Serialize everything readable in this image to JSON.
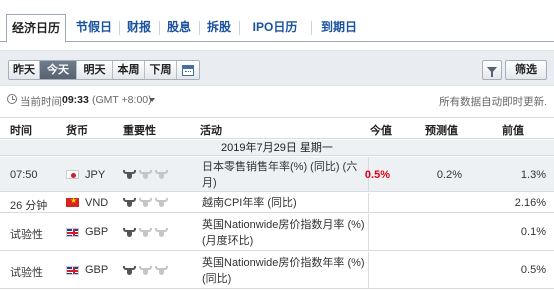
{
  "tabs": [
    {
      "label": "经济日历",
      "active": true
    },
    {
      "label": "节假日",
      "active": false
    },
    {
      "label": "财报",
      "active": false
    },
    {
      "label": "股息",
      "active": false
    },
    {
      "label": "拆股",
      "active": false
    },
    {
      "label": "IPO日历",
      "active": false
    },
    {
      "label": "到期日",
      "active": false
    }
  ],
  "toolbar": {
    "range_buttons": [
      {
        "label": "昨天",
        "active": false
      },
      {
        "label": "今天",
        "active": true
      },
      {
        "label": "明天",
        "active": false
      },
      {
        "label": "本周",
        "active": false
      },
      {
        "label": "下周",
        "active": false
      }
    ],
    "calendar_icon": "calendar-icon",
    "filter_icon": "funnel-icon",
    "filter_label": "筛选"
  },
  "time_bar": {
    "label": "当前时间:",
    "time": "09:33",
    "timezone": "(GMT +8:00)",
    "note": "所有数据自动即时更新."
  },
  "table": {
    "headers": {
      "time": "时间",
      "currency": "货币",
      "importance": "重要性",
      "event": "活动",
      "actual": "今值",
      "forecast": "预测值",
      "previous": "前值"
    },
    "date_label": "2019年7月29日  星期一",
    "rows": [
      {
        "time": "07:50",
        "flag": "jp",
        "currency": "JPY",
        "importance": 1,
        "event": "日本零售销售年率(%) (同比) (六月)",
        "actual": "0.5%",
        "actual_color": "#e0001a",
        "forecast": "0.2%",
        "previous": "1.3%"
      },
      {
        "time": "26 分钟",
        "flag": "vn",
        "currency": "VND",
        "importance": 1,
        "event": "越南CPI年率 (同比)",
        "actual": "",
        "actual_color": "#222222",
        "forecast": "",
        "previous": "2.16%"
      },
      {
        "time": "试验性",
        "flag": "gb",
        "currency": "GBP",
        "importance": 1,
        "event": "英国Nationwide房价指数月率 (%) (月度环比)",
        "actual": "",
        "actual_color": "#222222",
        "forecast": "",
        "previous": "0.1%"
      },
      {
        "time": "试验性",
        "flag": "gb",
        "currency": "GBP",
        "importance": 1,
        "event": "英国Nationwide房价指数年率 (%) (同比)",
        "actual": "",
        "actual_color": "#222222",
        "forecast": "",
        "previous": "0.5%"
      }
    ]
  }
}
